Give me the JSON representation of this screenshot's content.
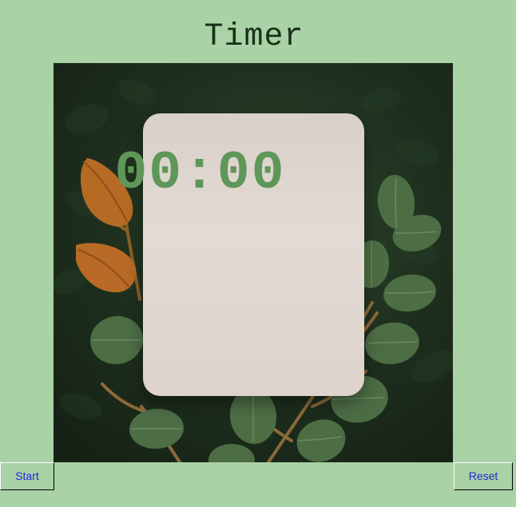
{
  "window": {
    "title": "Timer"
  },
  "timer": {
    "display": "00:00"
  },
  "buttons": {
    "start": "Start",
    "reset": "Reset"
  },
  "colors": {
    "background": "#a9d2a6",
    "title_text": "#173017",
    "timer_text": "#5f9758",
    "button_text": "#1d2ad8"
  }
}
